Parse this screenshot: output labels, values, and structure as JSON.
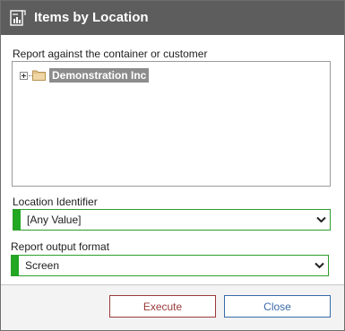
{
  "dialog": {
    "title": "Items by Location",
    "title_icon": "report-icon"
  },
  "container_section": {
    "label": "Report against the container or customer",
    "tree": {
      "root": {
        "label": "Demonstration Inc",
        "icon": "folder-icon",
        "expander_icon": "plus-expander-icon",
        "selected": true
      }
    }
  },
  "location_identifier": {
    "label": "Location Identifier",
    "value": "[Any Value]"
  },
  "output_format": {
    "label": "Report output format",
    "value": "Screen"
  },
  "buttons": {
    "execute": "Execute",
    "close": "Close"
  },
  "colors": {
    "titlebar": "#5d5d5d",
    "required_marker": "#22a822",
    "execute_border": "#9a3a3a",
    "close_border": "#3a6aa8",
    "selected_node": "#8c8c8c"
  }
}
